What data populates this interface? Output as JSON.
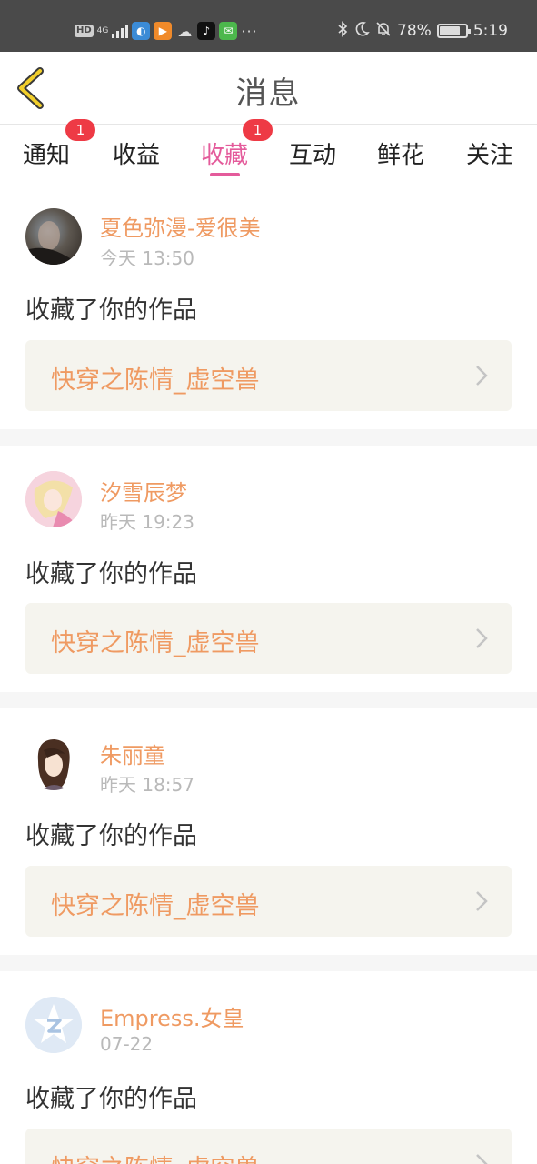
{
  "status_bar": {
    "hd": "HD",
    "network": "4G",
    "battery": "78%",
    "battery_level": 0.78,
    "time": "5:19",
    "more": "···"
  },
  "header": {
    "title": "消息",
    "back_icon": "chevron-left-icon"
  },
  "tabs": [
    {
      "label": "通知",
      "badge": "1",
      "active": false
    },
    {
      "label": "收益",
      "badge": "",
      "active": false
    },
    {
      "label": "收藏",
      "badge": "1",
      "active": true
    },
    {
      "label": "互动",
      "badge": "",
      "active": false
    },
    {
      "label": "鲜花",
      "badge": "",
      "active": false
    },
    {
      "label": "关注",
      "badge": "",
      "active": false
    }
  ],
  "colors": {
    "accent": "#e45b9b",
    "name_orange": "#ef9a62",
    "badge_red": "#ee3a45",
    "work_bg": "#f5f4ee"
  },
  "messages": [
    {
      "user": "夏色弥漫-爱很美",
      "time": "今天 13:50",
      "action": "收藏了你的作品",
      "work": "快穿之陈情_虚空兽",
      "avatar": "user-photo-avatar"
    },
    {
      "user": "汐雪辰梦",
      "time": "昨天 19:23",
      "action": "收藏了你的作品",
      "work": "快穿之陈情_虚空兽",
      "avatar": "anime-girl-avatar"
    },
    {
      "user": "朱丽童",
      "time": "昨天 18:57",
      "action": "收藏了你的作品",
      "work": "快穿之陈情_虚空兽",
      "avatar": "anime-boy-avatar"
    },
    {
      "user": "Empress.女皇",
      "time": "07-22",
      "action": "收藏了你的作品",
      "work": "快穿之陈情_虚空兽",
      "avatar": "default-star-avatar"
    }
  ]
}
